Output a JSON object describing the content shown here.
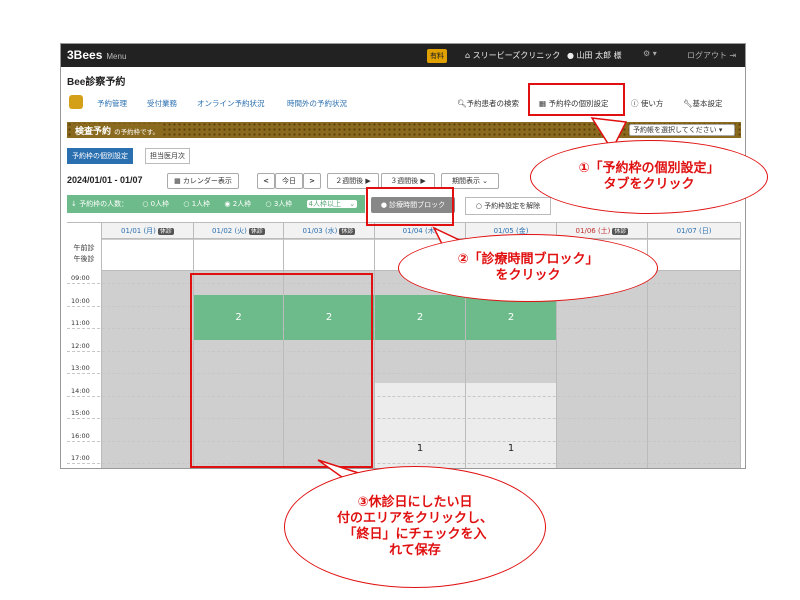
{
  "topbar": {
    "logo": "3Bees",
    "menu": "Menu",
    "paid_badge": "有料",
    "clinic": "スリービーズクリニック",
    "user": "山田 太郎 様",
    "logout": "ログアウト"
  },
  "app_title": "Bee診察予約",
  "nav": {
    "items": [
      "予約管理",
      "受付業務",
      "オンライン予約状況",
      "時間外の予約状況"
    ],
    "right": [
      "予約患者の検索",
      "予約枠の個別設定",
      "使い方",
      "基本設定"
    ]
  },
  "banner": {
    "title": "検査予約",
    "subtitle": "の予約枠です。",
    "select_placeholder": "予約帳を選択してください"
  },
  "subtabs": [
    "予約枠の個別設定",
    "担当医月次"
  ],
  "date_range": "2024/01/01 - 01/07",
  "toolbar": {
    "calendar": "カレンダー表示",
    "prev": "<",
    "today": "今日",
    "next": ">",
    "two_weeks": "２週間後",
    "three_weeks": "３週間後",
    "period": "期間表示"
  },
  "capacity": {
    "label": "予約枠の人数：",
    "options": [
      "0人枠",
      "1人枠",
      "2人枠",
      "3人枠"
    ],
    "selected": "2人枠",
    "more": "4人枠以上"
  },
  "block_button": "診療時間ブロック",
  "unset_button": "予約枠設定を解除",
  "grid": {
    "am_label": "午前診",
    "pm_label": "午後診",
    "times": [
      "09:00",
      "10:00",
      "11:00",
      "12:00",
      "13:00",
      "14:00",
      "15:00",
      "16:00",
      "17:00"
    ],
    "days": [
      {
        "label": "01/01 (月)",
        "holiday": "休診"
      },
      {
        "label": "01/02 (火)",
        "holiday": "休診"
      },
      {
        "label": "01/03 (水)",
        "holiday": "休診"
      },
      {
        "label": "01/04 (木)",
        "holiday": ""
      },
      {
        "label": "01/05 (金)",
        "holiday": ""
      },
      {
        "label": "01/06 (土)",
        "holiday": "休診"
      },
      {
        "label": "01/07 (日)",
        "holiday": ""
      }
    ],
    "green_value": "2",
    "pm_value": "1"
  },
  "callouts": {
    "c1": "①「予約枠の個別設定」\nタブをクリック",
    "c2": "②「診療時間ブロック」\nをクリック",
    "c3": "③休診日にしたい日\n付のエリアをクリックし、\n「終日」にチェックを入\nれて保存"
  },
  "colors": {
    "accent": "#2a6fb0",
    "green": "#6dbb8a",
    "callout_red": "#e01010"
  }
}
